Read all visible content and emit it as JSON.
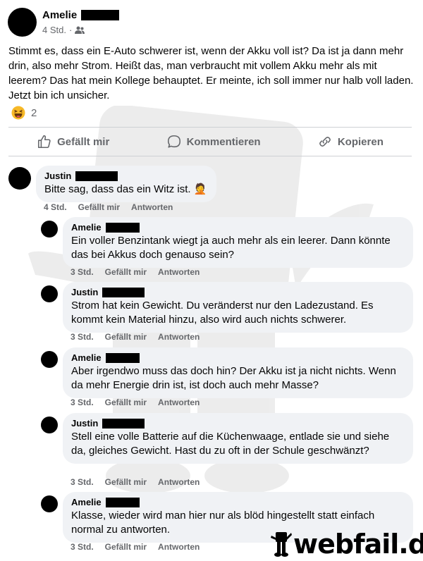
{
  "post": {
    "author": "Amelie",
    "time": "4 Std.",
    "separator": "·",
    "audience_icon": "friends-icon",
    "body": "Stimmt es, dass ein E-Auto schwerer ist, wenn der Akku voll ist? Da ist ja dann mehr drin, also mehr Strom. Heißt das, man verbraucht mit vollem Akku mehr als mit leerem? Das hat mein Kollege behauptet. Er meinte, ich soll immer nur halb voll laden. Jetzt bin ich unsicher.",
    "reaction_icon": "haha-emoji-icon",
    "reaction_count": "2"
  },
  "actions": {
    "like": "Gefällt mir",
    "comment": "Kommentieren",
    "copy": "Kopieren"
  },
  "comments": [
    {
      "author": "Justin",
      "text": "Bitte sag, dass das ein Witz ist. 🤦",
      "time": "4 Std.",
      "like": "Gefällt mir",
      "reply": "Antworten"
    },
    {
      "author": "Amelie",
      "text": "Ein voller Benzintank wiegt ja auch mehr als ein leerer. Dann könnte das bei Akkus doch genauso sein?",
      "time": "3 Std.",
      "like": "Gefällt mir",
      "reply": "Antworten"
    },
    {
      "author": "Justin",
      "text": "Strom hat kein Gewicht. Du veränderst nur den Ladezustand. Es kommt kein Material hinzu, also wird auch nichts schwerer.",
      "time": "3 Std.",
      "like": "Gefällt mir",
      "reply": "Antworten"
    },
    {
      "author": "Amelie",
      "text": "Aber irgendwo muss das doch hin? Der Akku ist ja nicht nichts. Wenn da mehr Energie drin ist, ist doch auch mehr Masse?",
      "time": "3 Std.",
      "like": "Gefällt mir",
      "reply": "Antworten"
    },
    {
      "author": "Justin",
      "text": "Stell eine volle Batterie auf die Küchenwaage, entlade sie und siehe da, gleiches Gewicht. Hast du zu oft in der Schule geschwänzt?",
      "time": "3 Std.",
      "like": "Gefällt mir",
      "reply": "Antworten"
    },
    {
      "author": "Amelie",
      "text": "Klasse, wieder wird man hier nur als blöd hingestellt statt einfach normal zu antworten.",
      "time": "3 Std.",
      "like": "Gefällt mir",
      "reply": "Antworten"
    }
  ],
  "watermark": {
    "text": "webfail.de"
  }
}
